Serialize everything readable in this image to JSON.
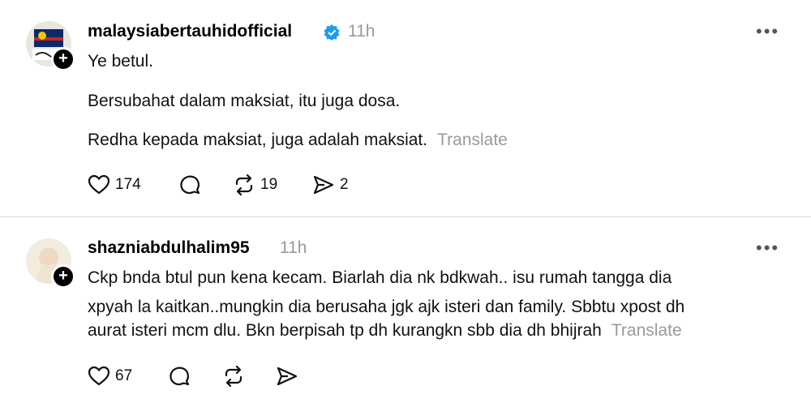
{
  "posts": [
    {
      "username": "malaysiabertauhidofficial",
      "time": "11h",
      "verified": true,
      "lines": [
        "Ye betul.",
        "Bersubahat dalam maksiat, itu juga dosa.",
        "Redha kepada maksiat, juga adalah maksiat."
      ],
      "translate": "Translate",
      "likes": "174",
      "reposts": "19",
      "shares": "2"
    },
    {
      "username": "shazniabdulhalim95",
      "time": "11h",
      "lines": [
        "Ckp bnda btul pun kena kecam. Biarlah dia nk bdkwah.. isu rumah tangga dia",
        "xpyah la kaitkan..mungkin dia berusaha jgk ajk isteri dan family. Sbbtu xpost dh",
        "aurat isteri mcm dlu. Bkn berpisah tp dh kurangkn sbb dia dh bhijrah"
      ],
      "translate": "Translate",
      "likes": "67"
    }
  ],
  "more_label": "•••",
  "colors": {
    "verified": "#1d9bf0",
    "muted": "#999999"
  }
}
